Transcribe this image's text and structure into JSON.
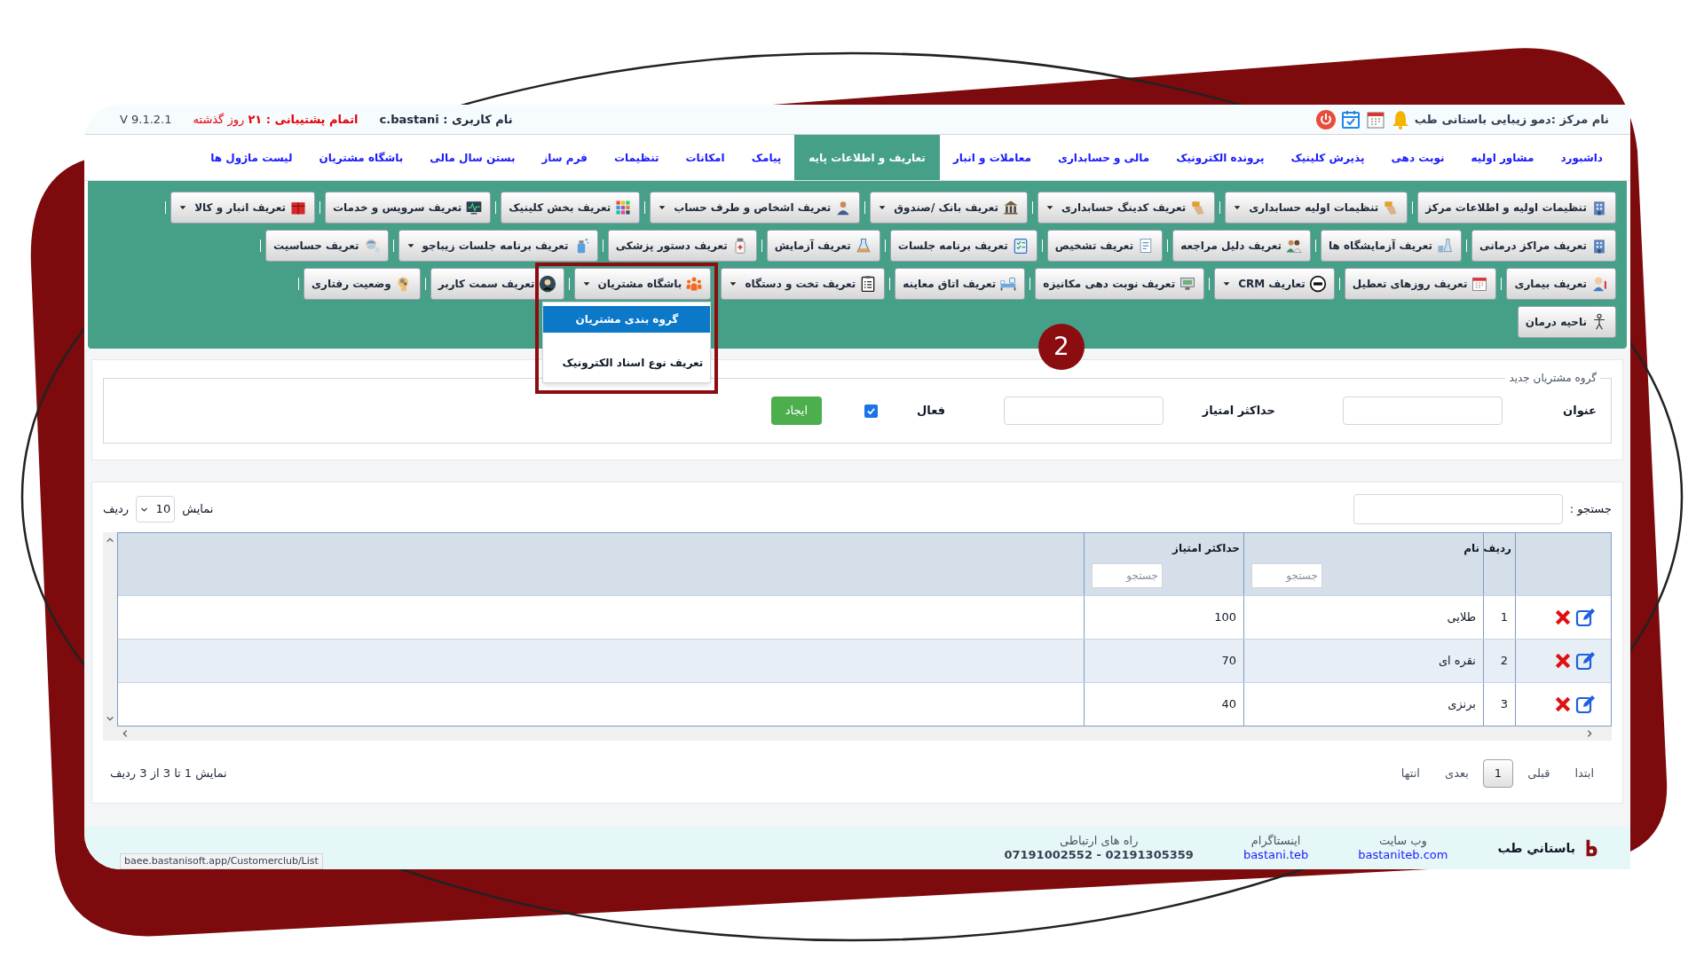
{
  "top_bar": {
    "center_name": "نام مرکز :دمو زیبایی باستانی طب",
    "user": "نام کاربری : c.bastani",
    "support": "**اتمام پشتیبانی : ۲۱** روز گذشته",
    "version": "V 9.1.2.1"
  },
  "menu": [
    {
      "label": "داشبورد",
      "selected": false
    },
    {
      "label": "مشاور اولیه",
      "selected": false
    },
    {
      "label": "نوبت دهی",
      "selected": false
    },
    {
      "label": "پذیرش کلینیک",
      "selected": false
    },
    {
      "label": "پرونده الکترونیک",
      "selected": false
    },
    {
      "label": "مالی و حسابداری",
      "selected": false
    },
    {
      "label": "معاملات و انبار",
      "selected": false
    },
    {
      "label": "تعاریف و اطلاعات پایه",
      "selected": true
    },
    {
      "label": "پیامک",
      "selected": false
    },
    {
      "label": "امکانات",
      "selected": false
    },
    {
      "label": "تنظیمات",
      "selected": false
    },
    {
      "label": "فرم ساز",
      "selected": false
    },
    {
      "label": "بستن سال مالی",
      "selected": false
    },
    {
      "label": "باشگاه مشتریان",
      "selected": false
    },
    {
      "label": "لیست ماژول ها",
      "selected": false
    }
  ],
  "toolbar_rows": [
    [
      {
        "label": "تنظیمات اولیه و اطلاعات مرکز",
        "dropdown": false
      },
      {
        "label": "تنظیمات اولیه حسابداری",
        "dropdown": true
      },
      {
        "label": "تعریف کدینگ حسابداری",
        "dropdown": true
      },
      {
        "label": "تعریف بانک /صندوق",
        "dropdown": true
      },
      {
        "label": "تعریف اشخاص و طرف حساب",
        "dropdown": true
      },
      {
        "label": "تعریف بخش کلینیک",
        "dropdown": false
      },
      {
        "label": "تعریف سرویس و خدمات",
        "dropdown": false
      },
      {
        "label": "تعریف انبار و کالا",
        "dropdown": true
      }
    ],
    [
      {
        "label": "تعریف مراکز درمانی",
        "dropdown": false
      },
      {
        "label": "تعریف آزمایشگاه ها",
        "dropdown": false
      },
      {
        "label": "تعریف دلیل مراجعه",
        "dropdown": false
      },
      {
        "label": "تعریف تشخیص",
        "dropdown": false
      },
      {
        "label": "تعریف برنامه جلسات",
        "dropdown": false
      },
      {
        "label": "تعریف آزمایش",
        "dropdown": false
      },
      {
        "label": "تعریف دستور پزشکی",
        "dropdown": false
      },
      {
        "label": "تعریف برنامه جلسات زیباجو",
        "dropdown": true
      },
      {
        "label": "تعریف حساسیت",
        "dropdown": false
      }
    ],
    [
      {
        "label": "تعریف بیماری",
        "dropdown": false
      },
      {
        "label": "تعریف روزهای تعطیل",
        "dropdown": false
      },
      {
        "label": "تعاریف CRM",
        "dropdown": true
      },
      {
        "label": "تعریف نوبت دهی مکانیزه",
        "dropdown": false
      },
      {
        "label": "تعریف اتاق معاینه",
        "dropdown": false
      },
      {
        "label": "تعریف تخت و دستگاه",
        "dropdown": true
      },
      {
        "label": "باشگاه مشتریان",
        "dropdown": true,
        "menu": [
          {
            "label": "گروه بندی مشتریان",
            "selected": true
          },
          {
            "label": "تعریف نوع اسناد الکترونیک",
            "selected": false
          }
        ]
      },
      {
        "label": "تعریف سمت کاربر",
        "dropdown": false
      },
      {
        "label": "وضعیت رفتاری",
        "dropdown": false
      }
    ],
    [
      {
        "label": "ناحیه درمان",
        "dropdown": false
      }
    ]
  ],
  "step_badge": "2",
  "form": {
    "legend": "گروه مشتریان جدید",
    "title_label": "عنوان",
    "max_label": "حداکثر امتیاز",
    "active_label": "فعال",
    "active_checked": true,
    "create_button": "ایجاد"
  },
  "table_controls": {
    "search_label": "جستجو :",
    "show_label": "نمایش",
    "page_size": "10",
    "rows_label": "ردیف"
  },
  "table": {
    "columns": [
      {
        "label": "ردیف"
      },
      {
        "label": "نام",
        "filter_placeholder": "جستجو"
      },
      {
        "label": "حداکثر امتیاز",
        "filter_placeholder": "جستجو"
      }
    ],
    "rows": [
      {
        "index": "1",
        "name": "طلایی",
        "max": "100"
      },
      {
        "index": "2",
        "name": "نقره ای",
        "max": "70"
      },
      {
        "index": "3",
        "name": "برنزی",
        "max": "40"
      }
    ]
  },
  "pagination": {
    "buttons": [
      {
        "label": "ابتدا",
        "selected": false
      },
      {
        "label": "قبلی",
        "selected": false
      },
      {
        "label": "1",
        "selected": true
      },
      {
        "label": "بعدی",
        "selected": false
      },
      {
        "label": "انتها",
        "selected": false
      }
    ],
    "info": "نمایش 1 تا 3 از 3 ردیف"
  },
  "footer": {
    "brand": "باستاني طب",
    "links": [
      {
        "caption": "وب سایت",
        "value": "bastaniteb.com",
        "kind": "link"
      },
      {
        "caption": "اینستاگرام",
        "value": "bastani.teb",
        "kind": "link"
      },
      {
        "caption": "راه های ارتباطی",
        "value": "07191002552 - 02191305359",
        "kind": "phone"
      }
    ]
  },
  "status_url": "baee.bastanisoft.app/Customerclub/List"
}
